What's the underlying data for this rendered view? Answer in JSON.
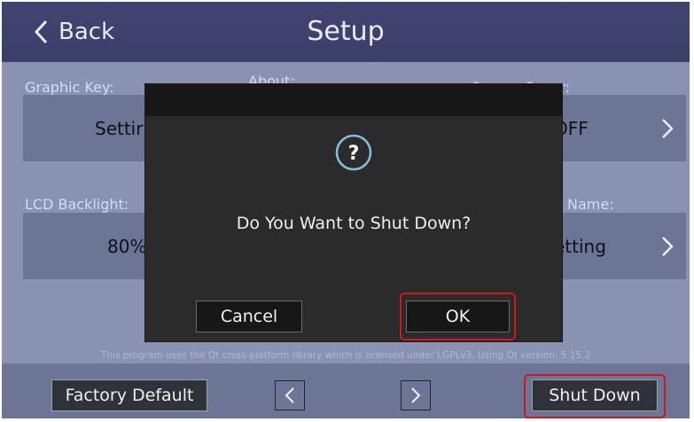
{
  "header": {
    "back_label": "Back",
    "title": "Setup"
  },
  "sections": {
    "graphic_key": {
      "label": "Graphic Key:",
      "value": "Settir"
    },
    "about": {
      "label": "About:"
    },
    "screen_saver": {
      "label": "Screen Saver:",
      "value": "OFF"
    },
    "lcd_backlight": {
      "label": "LCD Backlight:",
      "value": "80%"
    },
    "name": {
      "label": "Name:",
      "value": "etting"
    }
  },
  "license_text": "This program uses the Qt cross-platform library which is licensed under LGPLv3. Using Qt version: 5.15.2",
  "bottom_bar": {
    "factory_default_label": "Factory Default",
    "prev_icon": "chevron-left-icon",
    "next_icon": "chevron-right-icon",
    "shut_down_label": "Shut Down"
  },
  "dialog": {
    "icon": "question-icon",
    "message": "Do You Want to Shut Down?",
    "cancel_label": "Cancel",
    "ok_label": "OK"
  },
  "colors": {
    "header_bg": "#3f4570",
    "body_bg": "#8a92b4",
    "tile_bg": "#6d7596",
    "dialog_bg": "#2b2b2b",
    "highlight": "#d01818",
    "accent_icon": "#7fc2e0"
  }
}
